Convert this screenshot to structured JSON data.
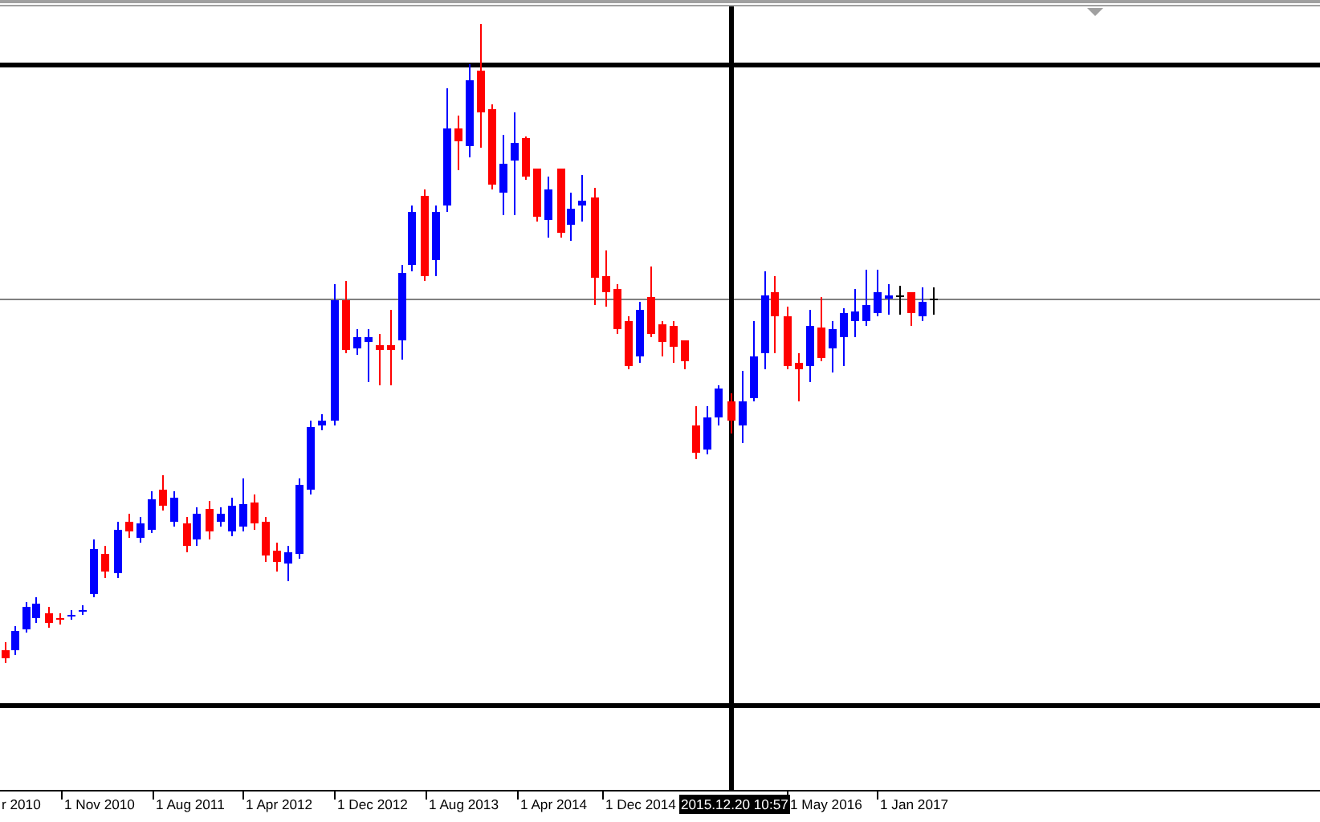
{
  "x_axis": {
    "labels": [
      {
        "text": "r 2010",
        "kind": "tick"
      },
      {
        "text": "1 Nov 2010",
        "kind": "tick"
      },
      {
        "text": "1 Aug 2011",
        "kind": "tick"
      },
      {
        "text": "1 Apr 2012",
        "kind": "tick"
      },
      {
        "text": "1 Dec 2012",
        "kind": "tick"
      },
      {
        "text": "1 Aug 2013",
        "kind": "tick"
      },
      {
        "text": "1 Apr 2014",
        "kind": "tick"
      },
      {
        "text": "1 Dec 2014",
        "kind": "tick"
      },
      {
        "text": "2015.12.20 10:57",
        "kind": "cursor"
      },
      {
        "text": "1 May 2016",
        "kind": "tick"
      },
      {
        "text": "1 Jan 2017",
        "kind": "tick"
      }
    ]
  }
}
